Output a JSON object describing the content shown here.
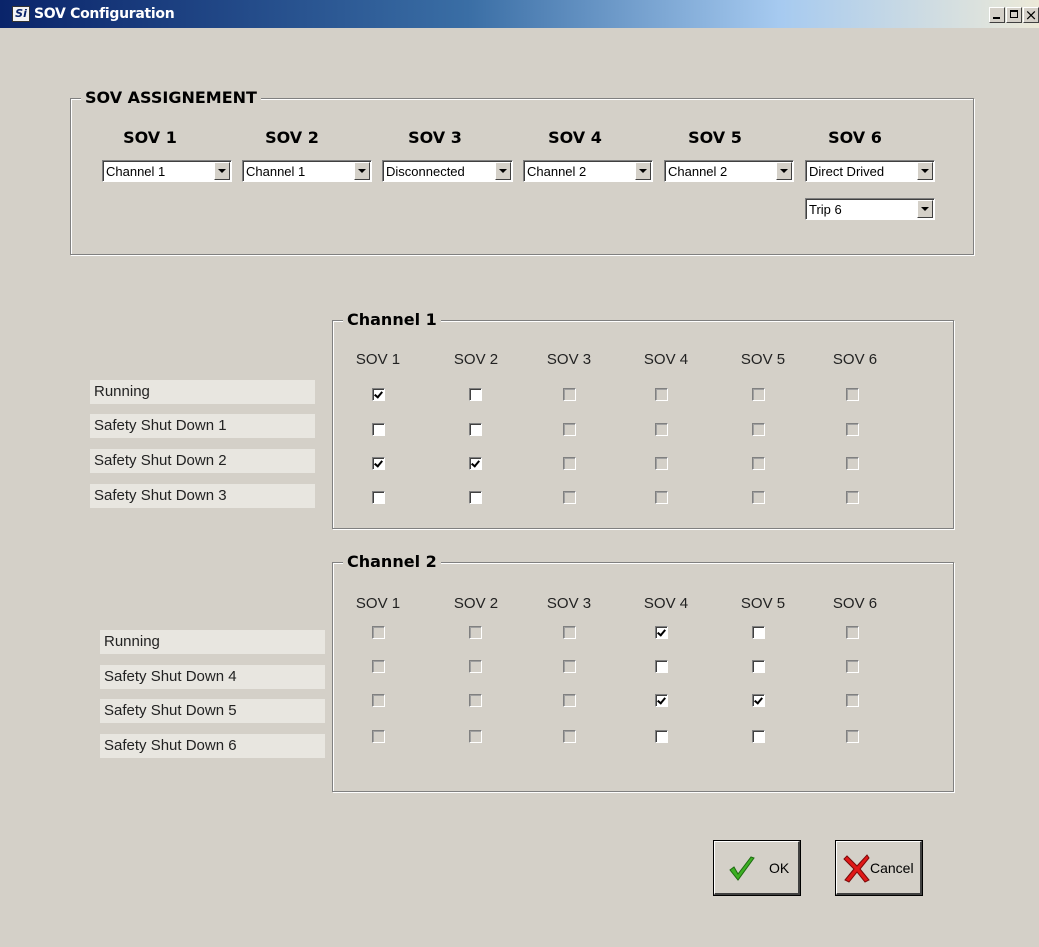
{
  "window": {
    "title": "SOV Configuration",
    "icon": "si-logo-icon",
    "controls": [
      "minimize-icon",
      "maximize-icon",
      "close-icon"
    ],
    "close_glyph": "×"
  },
  "assignment": {
    "title": "SOV ASSIGNEMENT",
    "headers": [
      "SOV 1",
      "SOV 2",
      "SOV 3",
      "SOV 4",
      "SOV 5",
      "SOV 6"
    ],
    "values": [
      "Channel 1",
      "Channel 1",
      "Disconnected",
      "Channel 2",
      "Channel 2",
      "Direct Drived"
    ],
    "trip_value": "Trip 6"
  },
  "channel1": {
    "title": "Channel 1",
    "columns": [
      "SOV 1",
      "SOV 2",
      "SOV 3",
      "SOV 4",
      "SOV 5",
      "SOV 6"
    ],
    "rows": [
      {
        "label": "Running",
        "checks": [
          true,
          false,
          false,
          false,
          false,
          false
        ],
        "enabled": [
          true,
          true,
          false,
          false,
          false,
          false
        ]
      },
      {
        "label": "Safety Shut Down 1",
        "checks": [
          false,
          false,
          false,
          false,
          false,
          false
        ],
        "enabled": [
          true,
          true,
          false,
          false,
          false,
          false
        ]
      },
      {
        "label": "Safety Shut Down 2",
        "checks": [
          true,
          true,
          false,
          false,
          false,
          false
        ],
        "enabled": [
          true,
          true,
          false,
          false,
          false,
          false
        ]
      },
      {
        "label": "Safety Shut Down 3",
        "checks": [
          false,
          false,
          false,
          false,
          false,
          false
        ],
        "enabled": [
          true,
          true,
          false,
          false,
          false,
          false
        ]
      }
    ]
  },
  "channel2": {
    "title": "Channel 2",
    "columns": [
      "SOV 1",
      "SOV 2",
      "SOV 3",
      "SOV 4",
      "SOV 5",
      "SOV 6"
    ],
    "rows": [
      {
        "label": "Running",
        "checks": [
          false,
          false,
          false,
          true,
          false,
          false
        ],
        "enabled": [
          false,
          false,
          false,
          true,
          true,
          false
        ]
      },
      {
        "label": "Safety Shut Down 4",
        "checks": [
          false,
          false,
          false,
          false,
          false,
          false
        ],
        "enabled": [
          false,
          false,
          false,
          true,
          true,
          false
        ]
      },
      {
        "label": "Safety Shut Down 5",
        "checks": [
          false,
          false,
          false,
          true,
          true,
          false
        ],
        "enabled": [
          false,
          false,
          false,
          true,
          true,
          false
        ]
      },
      {
        "label": "Safety Shut Down 6",
        "checks": [
          false,
          false,
          false,
          false,
          false,
          false
        ],
        "enabled": [
          false,
          false,
          false,
          true,
          true,
          false
        ]
      }
    ]
  },
  "buttons": {
    "ok": {
      "label": "OK",
      "icon": "green-check-icon"
    },
    "cancel": {
      "label": "Cancel",
      "icon": "red-x-icon"
    }
  }
}
